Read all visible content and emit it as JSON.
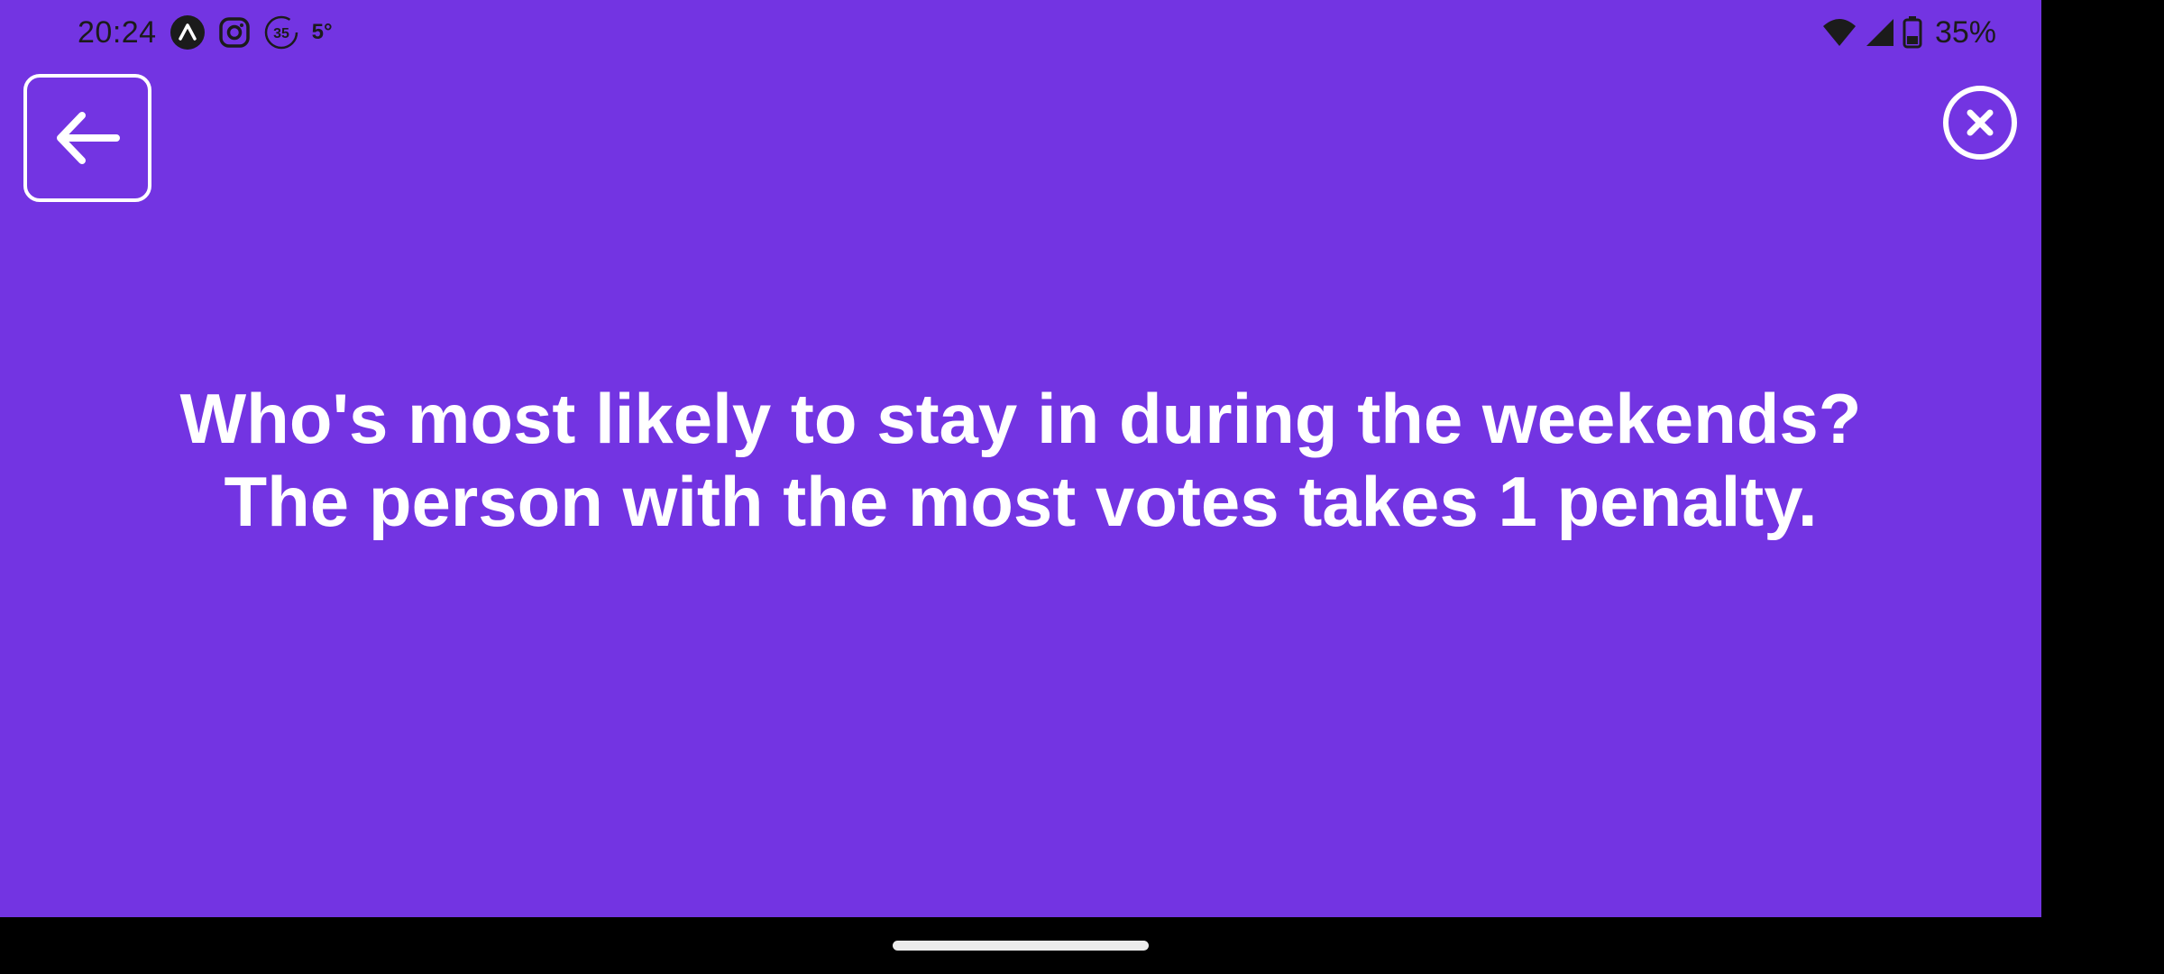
{
  "status_bar": {
    "time": "20:24",
    "notification_icons": [
      "app-a-icon",
      "instagram-icon",
      "badge-35-icon"
    ],
    "badge_number": "35",
    "temperature": "5°",
    "battery_percent": "35%",
    "signal_icons": [
      "wifi-icon",
      "cellular-signal-icon",
      "battery-icon"
    ]
  },
  "toolbar": {
    "back_icon": "arrow-left-icon",
    "close_icon": "close-circle-icon"
  },
  "card": {
    "prompt": "Who's most likely to stay in during the weekends? The person with the most votes takes 1 penalty."
  },
  "colors": {
    "background": "#7334E2",
    "text": "#FFFFFF",
    "status_text": "#1B1B1B"
  }
}
